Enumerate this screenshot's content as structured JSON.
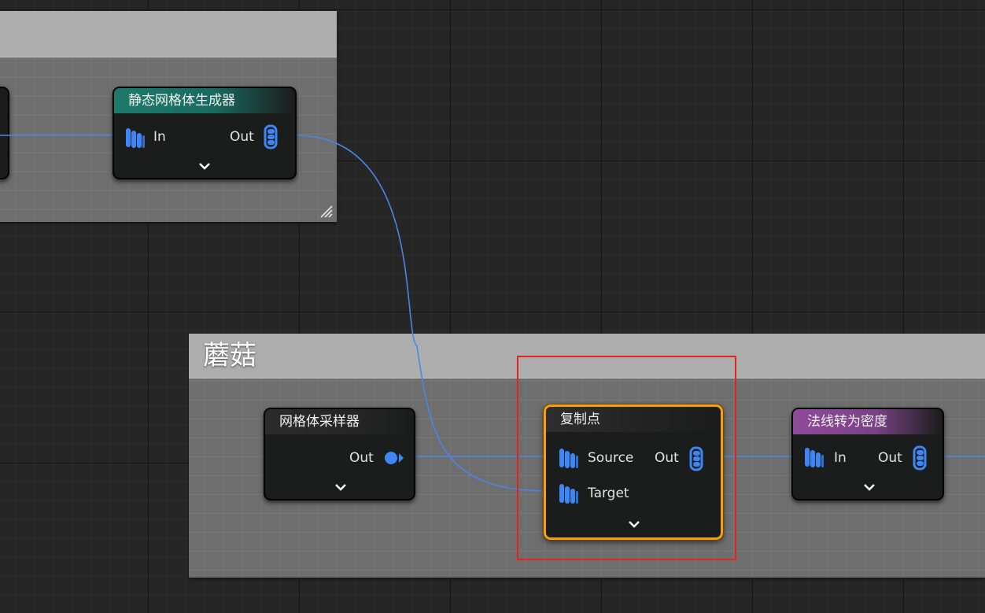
{
  "comments": {
    "top": {
      "title": ""
    },
    "bottom": {
      "title": "蘑菇"
    }
  },
  "nodes": {
    "static_mesh_spawner": {
      "title": "静态网格体生成器",
      "in_label": "In",
      "out_label": "Out",
      "header_color": "#1e7a6a"
    },
    "mesh_sampler": {
      "title": "网格体采样器",
      "out_label": "Out"
    },
    "copy_points": {
      "title": "复制点",
      "source_label": "Source",
      "target_label": "Target",
      "out_label": "Out"
    },
    "normal_to_density": {
      "title": "法线转为密度",
      "in_label": "In",
      "out_label": "Out",
      "header_color": "#8a4a96"
    }
  },
  "colors": {
    "wire": "#4a86e8",
    "pin": "#3d86f5",
    "selection": "#f5a10f",
    "highlight_box": "#e3241d"
  }
}
